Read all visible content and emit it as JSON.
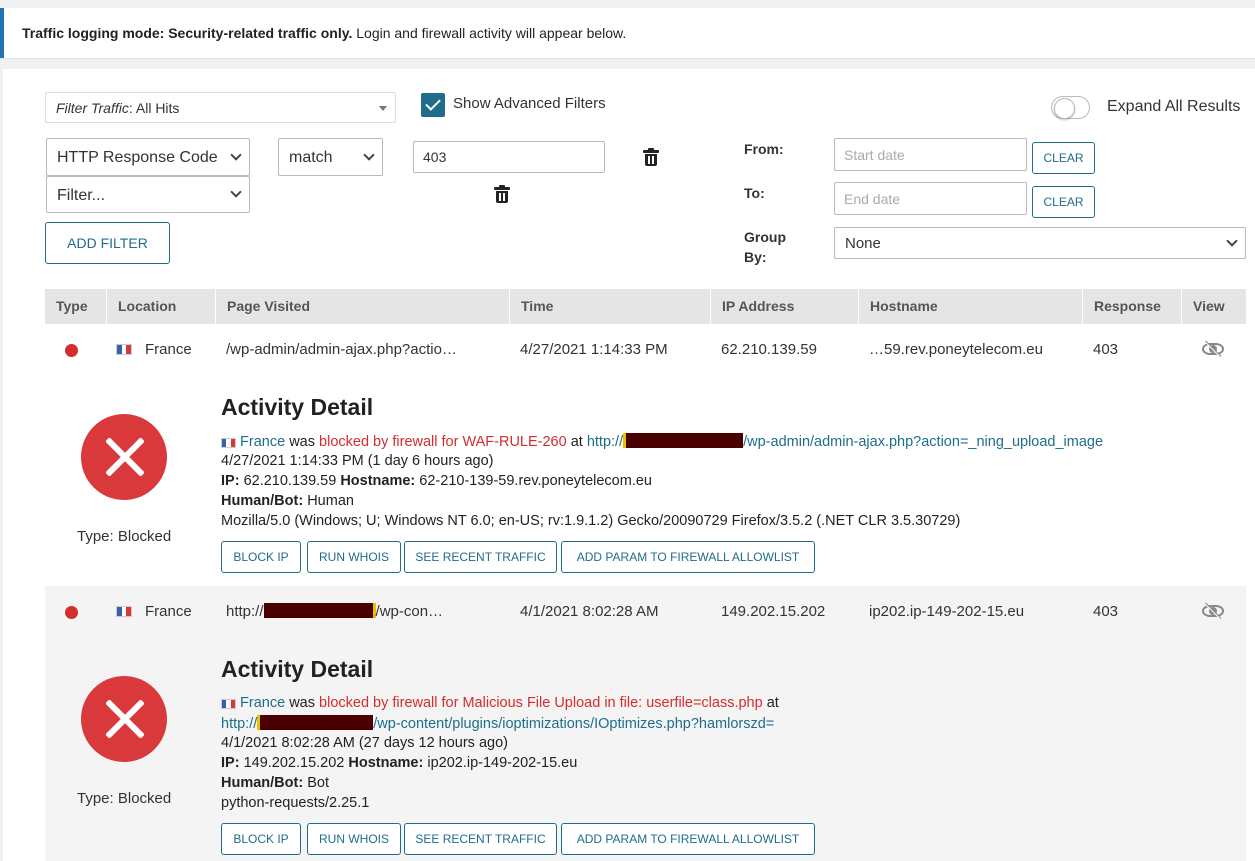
{
  "notice": {
    "bold": "Traffic logging mode: Security-related traffic only.",
    "rest": "Login and firewall activity will appear below."
  },
  "filters": {
    "filter_traffic_label": "Filter Traffic",
    "filter_traffic_value": ": All Hits",
    "show_advanced_label": "Show Advanced Filters",
    "show_advanced_checked": true,
    "expand_all_label": "Expand All Results",
    "filter1_field": "HTTP Response Code",
    "filter1_operator": "match",
    "filter1_value": "403",
    "filter2_field": "Filter...",
    "add_filter_label": "ADD FILTER",
    "from_label": "From:",
    "to_label": "To:",
    "start_date_placeholder": "Start date",
    "end_date_placeholder": "End date",
    "clear_label": "CLEAR",
    "group_by_label_1": "Group",
    "group_by_label_2": "By:",
    "group_by_value": "None"
  },
  "table": {
    "headers": [
      "Type",
      "Location",
      "Page Visited",
      "Time",
      "IP Address",
      "Hostname",
      "Response",
      "View"
    ]
  },
  "rows": [
    {
      "location": "France",
      "page": "/wp-admin/admin-ajax.php?actio…",
      "time": "4/27/2021 1:14:33 PM",
      "ip": "62.210.139.59",
      "hostname": "…59.rev.poneytelecom.eu",
      "response": "403",
      "detail": {
        "title": "Activity Detail",
        "country": "France",
        "was": "was",
        "blocked_msg": "blocked by firewall for WAF-RULE-260",
        "at": "at",
        "url_prefix": "http://",
        "url_suffix": "/wp-admin/admin-ajax.php?action=_ning_upload_image",
        "time_line": "4/27/2021 1:14:33 PM (1 day 6 hours ago)",
        "ip_label": "IP:",
        "ip_value": "62.210.139.59",
        "hostname_label": "Hostname:",
        "hostname_value": "62-210-139-59.rev.poneytelecom.eu",
        "humanbot_label": "Human/Bot:",
        "humanbot_value": "Human",
        "user_agent": "Mozilla/5.0 (Windows; U; Windows NT 6.0; en-US; rv:1.9.1.2) Gecko/20090729 Firefox/3.5.2 (.NET CLR 3.5.30729)",
        "type_label": "Type: Blocked"
      }
    },
    {
      "location": "France",
      "page_prefix": "http://",
      "page_suffix": "/wp-con…",
      "time": "4/1/2021 8:02:28 AM",
      "ip": "149.202.15.202",
      "hostname": "ip202.ip-149-202-15.eu",
      "response": "403",
      "detail": {
        "title": "Activity Detail",
        "country": "France",
        "was": "was",
        "blocked_msg": "blocked by firewall for Malicious File Upload in file: userfile=class.php",
        "at": "at",
        "url_prefix": "http://",
        "url_suffix": "/wp-content/plugins/ioptimizations/IOptimizes.php?hamlorszd=",
        "time_line": "4/1/2021 8:02:28 AM (27 days 12 hours ago)",
        "ip_label": "IP:",
        "ip_value": "149.202.15.202",
        "hostname_label": "Hostname:",
        "hostname_value": "ip202.ip-149-202-15.eu",
        "humanbot_label": "Human/Bot:",
        "humanbot_value": "Bot",
        "user_agent": "python-requests/2.25.1",
        "type_label": "Type: Blocked"
      }
    }
  ],
  "actions": {
    "block_ip": "BLOCK IP",
    "run_whois": "RUN WHOIS",
    "see_recent_traffic": "SEE RECENT TRAFFIC",
    "add_param": "ADD PARAM TO FIREWALL ALLOWLIST"
  },
  "icons": {
    "status": "blocked-dot-icon",
    "flag": "france-flag-icon",
    "view": "eye-slash-icon",
    "blocked": "x-circle-icon",
    "delete": "trash-icon"
  },
  "colors": {
    "accent": "#1e6d8c",
    "blocked_red": "#d42d2d",
    "notice_border": "#2271b1"
  }
}
